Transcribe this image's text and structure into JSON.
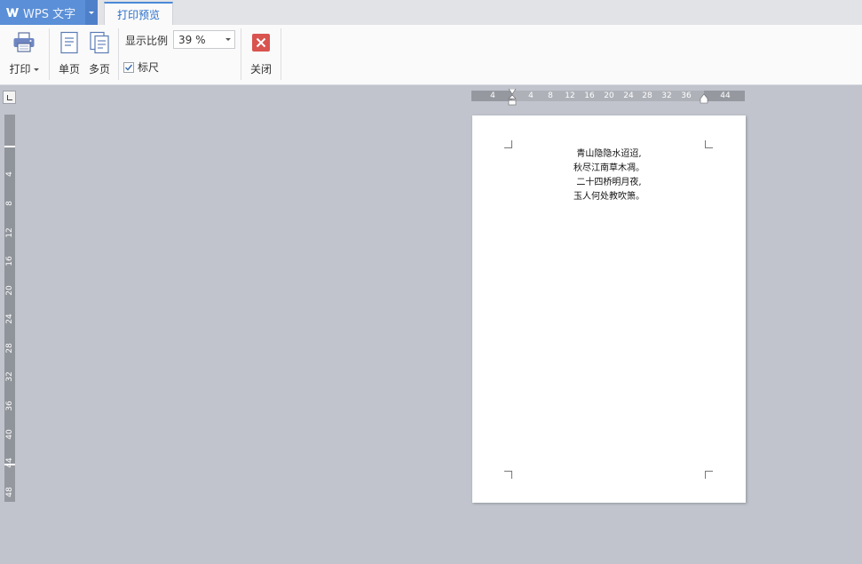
{
  "titlebar": {
    "app_title": "WPS 文字",
    "tab_label": "打印预览"
  },
  "ribbon": {
    "print_label": "打印",
    "single_page_label": "单页",
    "multi_page_label": "多页",
    "zoom_label": "显示比例",
    "zoom_value": "39 %",
    "ruler_label": "标尺",
    "ruler_checked": true,
    "close_label": "关闭"
  },
  "hruler": {
    "ticks": [
      "4",
      "4",
      "8",
      "12",
      "16",
      "20",
      "24",
      "28",
      "32",
      "36",
      "44"
    ]
  },
  "vruler": {
    "ticks": [
      "4",
      "8",
      "12",
      "16",
      "20",
      "24",
      "28",
      "32",
      "36",
      "40",
      "44",
      "48"
    ]
  },
  "document": {
    "lines": [
      "青山隐隐水迢迢,",
      "秋尽江南草木凋。",
      "二十四桥明月夜,",
      "玉人何处教吹箫。"
    ]
  },
  "colors": {
    "accent": "#4b89d8",
    "app_button": "#5b8fd7",
    "workspace": "#c1c4cd",
    "close_icon": "#d9534f"
  }
}
